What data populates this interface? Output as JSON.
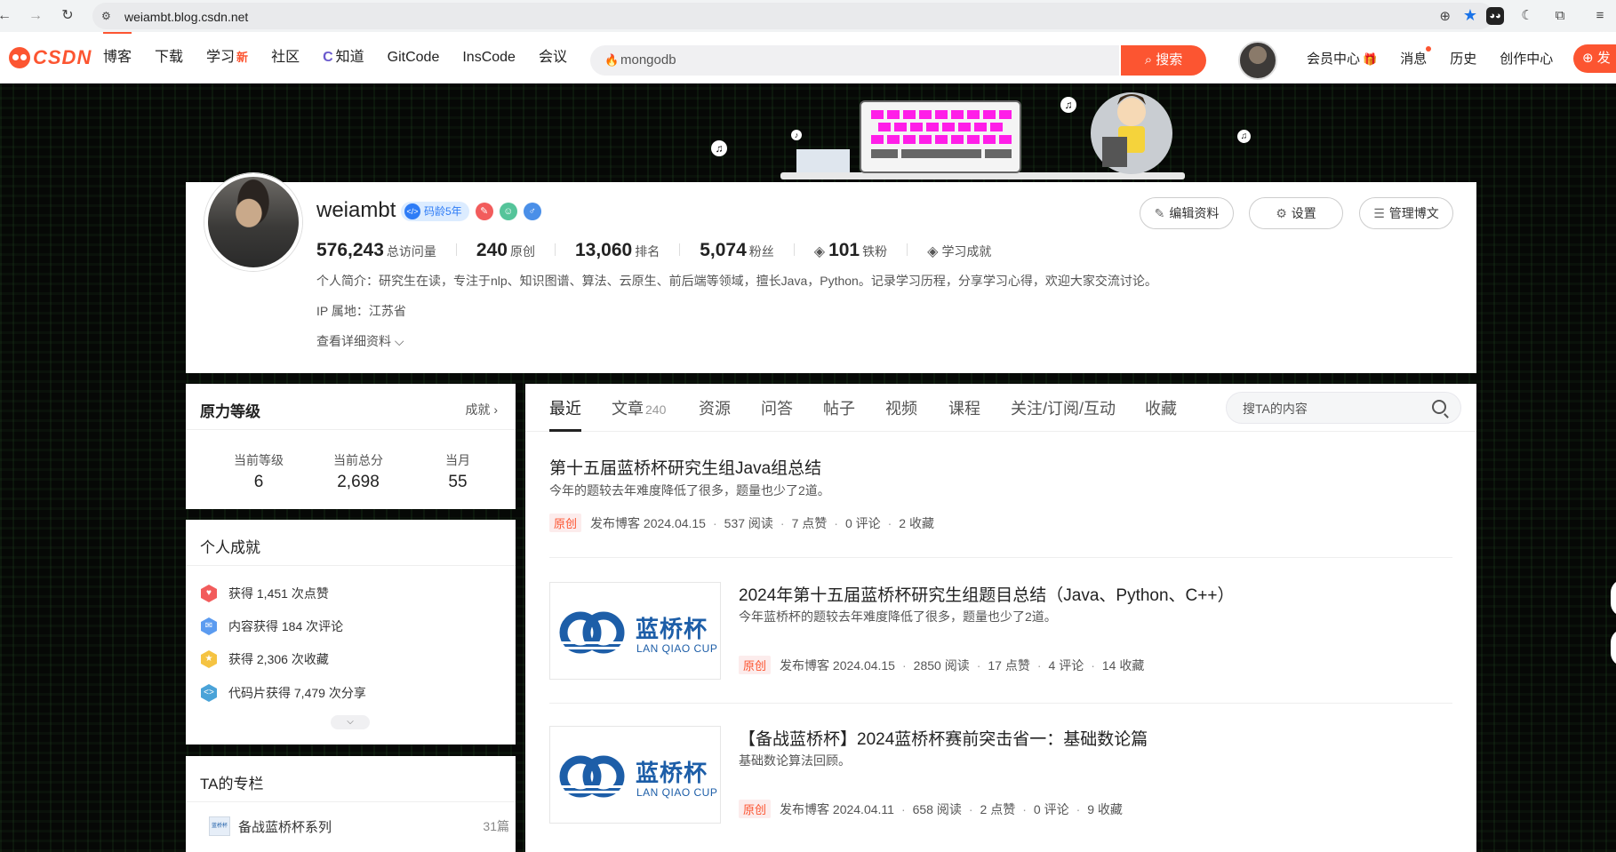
{
  "browser": {
    "url": "weiambt.blog.csdn.net"
  },
  "csdn_nav": {
    "logo": "CSDN",
    "items": [
      {
        "label": "博客",
        "badge": ""
      },
      {
        "label": "下载",
        "badge": ""
      },
      {
        "label": "学习",
        "badge": "新"
      },
      {
        "label": "社区",
        "badge": ""
      },
      {
        "label": "知道",
        "badge": ""
      },
      {
        "label": "GitCode",
        "badge": ""
      },
      {
        "label": "InsCode",
        "badge": ""
      },
      {
        "label": "会议",
        "badge": ""
      }
    ],
    "search_value": "mongodb",
    "search_button": "搜索",
    "right_items": [
      "会员中心",
      "消息",
      "历史",
      "创作中心"
    ],
    "publish": "发"
  },
  "profile": {
    "name": "weiambt",
    "code_age_badge": "码龄5年",
    "stats": [
      {
        "value": "576,243",
        "label": "总访问量"
      },
      {
        "value": "240",
        "label": "原创"
      },
      {
        "value": "13,060",
        "label": "排名"
      },
      {
        "value": "5,074",
        "label": "粉丝"
      },
      {
        "value": "101",
        "label": "铁粉"
      }
    ],
    "study_achievement": "学习成就",
    "bio": "个人简介：研究生在读，专注于nlp、知识图谱、算法、云原生、前后端等领域，擅长Java，Python。记录学习历程，分享学习心得，欢迎大家交流讨论。",
    "ip": "IP 属地：江苏省",
    "more": "查看详细资料",
    "buttons": {
      "edit": "编辑资料",
      "settings": "设置",
      "manage": "管理博文"
    }
  },
  "level_card": {
    "title": "原力等级",
    "link": "成就",
    "cells": [
      {
        "label": "当前等级",
        "value": "6"
      },
      {
        "label": "当前总分",
        "value": "2,698"
      },
      {
        "label": "当月",
        "value": "55"
      }
    ]
  },
  "achievements": {
    "title": "个人成就",
    "items": [
      "获得 1,451 次点赞",
      "内容获得 184 次评论",
      "获得 2,306 次收藏",
      "代码片获得 7,479 次分享"
    ],
    "colors": [
      "#f25c5c",
      "#5b9bf0",
      "#f5c342",
      "#4aa3d8"
    ]
  },
  "columns": {
    "title": "TA的专栏",
    "items": [
      {
        "name": "备战蓝桥杯系列",
        "count": "31篇"
      }
    ]
  },
  "tabs": {
    "items": [
      {
        "label": "最近",
        "count": ""
      },
      {
        "label": "文章",
        "count": "240"
      },
      {
        "label": "资源",
        "count": ""
      },
      {
        "label": "问答",
        "count": ""
      },
      {
        "label": "帖子",
        "count": ""
      },
      {
        "label": "视频",
        "count": ""
      },
      {
        "label": "课程",
        "count": ""
      },
      {
        "label": "关注/订阅/互动",
        "count": ""
      },
      {
        "label": "收藏",
        "count": ""
      }
    ],
    "search_placeholder": "搜TA的内容"
  },
  "articles": [
    {
      "title": "第十五届蓝桥杯研究生组Java组总结",
      "desc": "今年的题较去年难度降低了很多，题量也少了2道。",
      "tag": "原创",
      "publish": "发布博客 2024.04.15",
      "reads": "537 阅读",
      "likes": "7 点赞",
      "comments": "0 评论",
      "favs": "2 收藏"
    },
    {
      "title": "2024年第十五届蓝桥杯研究生组题目总结（Java、Python、C++）",
      "desc": "今年蓝桥杯的题较去年难度降低了很多，题量也少了2道。",
      "tag": "原创",
      "publish": "发布博客 2024.04.15",
      "reads": "2850 阅读",
      "likes": "17 点赞",
      "comments": "4 评论",
      "favs": "14 收藏",
      "thumb_cn": "蓝桥杯",
      "thumb_en": "LAN QIAO CUP"
    },
    {
      "title": "【备战蓝桥杯】2024蓝桥杯赛前突击省一：基础数论篇",
      "desc": "基础数论算法回顾。",
      "tag": "原创",
      "publish": "发布博客 2024.04.11",
      "reads": "658 阅读",
      "likes": "2 点赞",
      "comments": "0 评论",
      "favs": "9 收藏",
      "thumb_cn": "蓝桥杯",
      "thumb_en": "LAN QIAO CUP"
    }
  ],
  "colors": {
    "brand": "#fc5531",
    "link_blue": "#1d5ea8"
  }
}
